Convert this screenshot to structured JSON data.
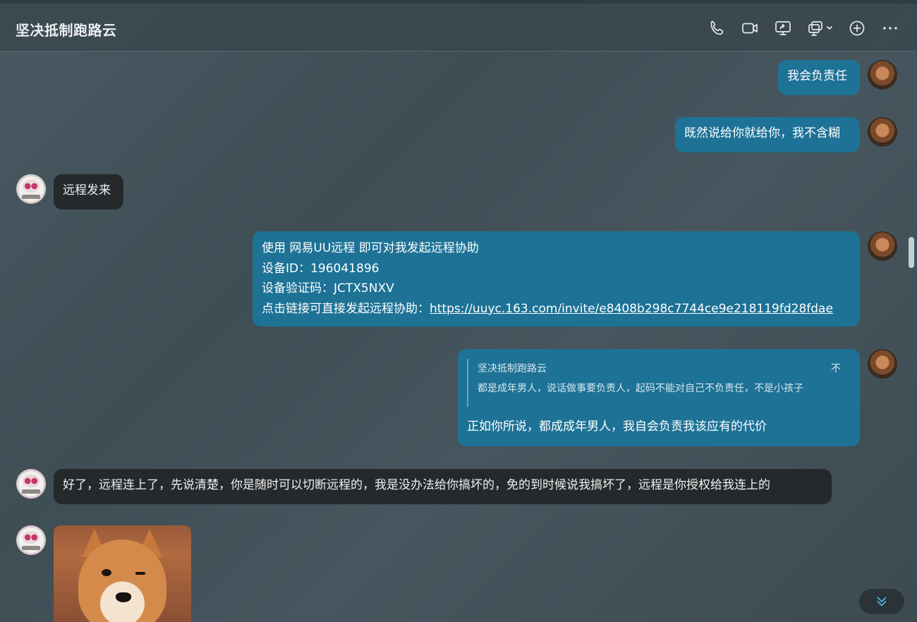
{
  "header": {
    "title": "坚决抵制跑路云",
    "tools": [
      "phone-icon",
      "video-icon",
      "screen-share-icon",
      "remote-desktop-icon",
      "add-icon",
      "more-icon"
    ]
  },
  "messages": [
    {
      "from": "me",
      "text": "我会负责任"
    },
    {
      "from": "me",
      "text": "既然说给你就给你，我不含糊"
    },
    {
      "from": "other",
      "text": "远程发来"
    },
    {
      "from": "me",
      "lines": [
        "使用 网易UU远程 即可对我发起远程协助",
        "设备ID：196041896",
        "设备验证码：JCTX5NXV"
      ],
      "link_prefix": "点击链接可直接发起远程协助：",
      "link": "https://uuyc.163.com/invite/e8408b298c7744ce9e218119fd28fdae"
    },
    {
      "from": "me",
      "quote": {
        "name": "坚决抵制跑路云",
        "text": "都是成年男人，说话做事要负责人，起码不能对自己不负责任，不是小孩子",
        "flag": "不"
      },
      "text": "正如你所说，都成成年男人，我自会负责我该应有的代价"
    },
    {
      "from": "other",
      "text": "好了，远程连上了，先说清楚，你是随时可以切断远程的，我是没办法给你搞坏的，免的到时候说我搞坏了，远程是你授权给我连上的"
    },
    {
      "from": "other",
      "image": "shiba-inu-winking-sticker"
    }
  ],
  "colors": {
    "my_bubble": "#1d7296",
    "other_bubble": "#25292c"
  }
}
